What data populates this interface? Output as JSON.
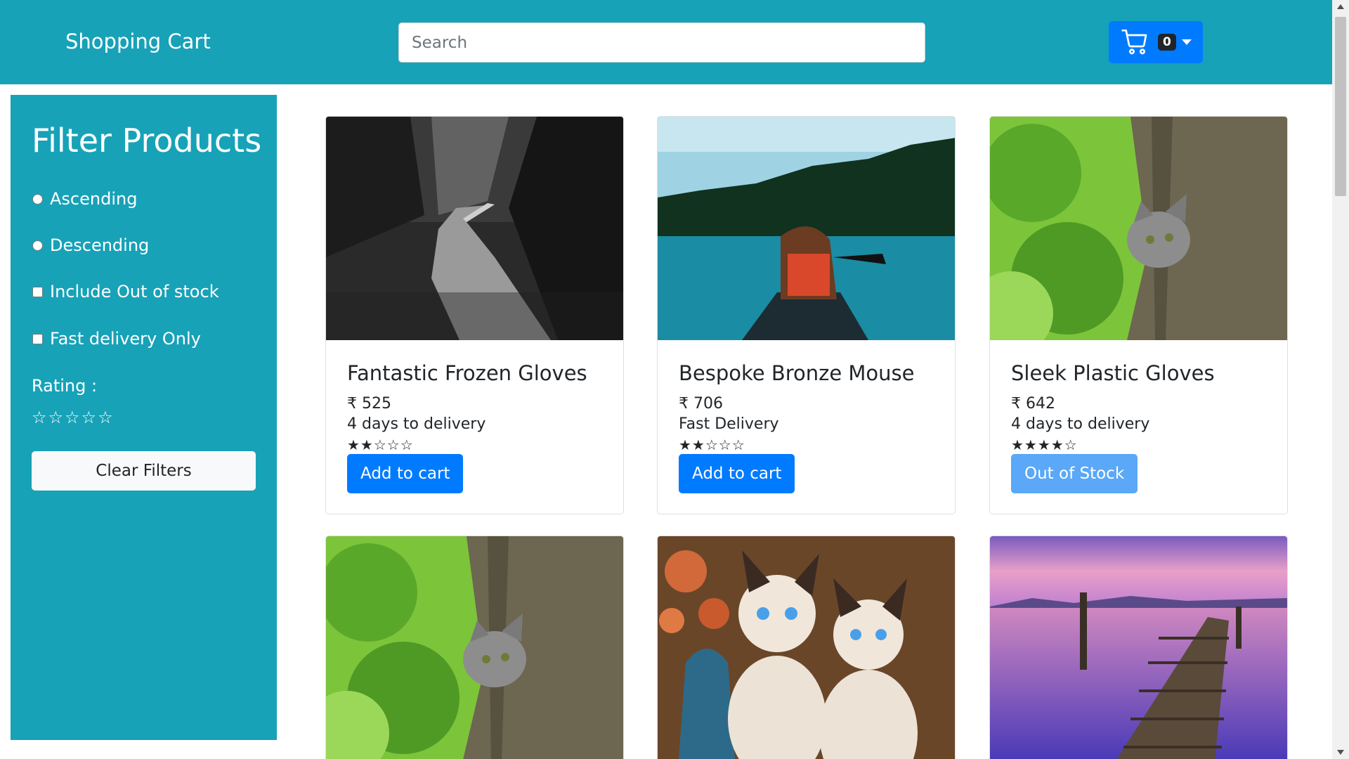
{
  "header": {
    "brand": "Shopping Cart",
    "search_placeholder": "Search",
    "cart_count": "0"
  },
  "filters": {
    "title": "Filter Products",
    "ascending": "Ascending",
    "descending": "Descending",
    "include_out_of_stock": "Include Out of stock",
    "fast_delivery_only": "Fast delivery Only",
    "rating_label": "Rating :",
    "rating_stars": "☆☆☆☆☆",
    "clear_button": "Clear Filters"
  },
  "products": [
    {
      "name": "Fantastic Frozen Gloves",
      "price": "₹ 525",
      "delivery": "4 days to delivery",
      "rating": 2,
      "stars": "★★☆☆☆",
      "button": "Add to cart",
      "in_stock": true,
      "image": "forest-road-photo"
    },
    {
      "name": "Bespoke Bronze Mouse",
      "price": "₹ 706",
      "delivery": "Fast Delivery",
      "rating": 2,
      "stars": "★★☆☆☆",
      "button": "Add to cart",
      "in_stock": true,
      "image": "canoe-lake-photo"
    },
    {
      "name": "Sleek Plastic Gloves",
      "price": "₹ 642",
      "delivery": "4 days to delivery",
      "rating": 4,
      "stars": "★★★★☆",
      "button": "Out of Stock",
      "in_stock": false,
      "image": "cat-tree-photo"
    },
    {
      "image": "cat-tree-photo"
    },
    {
      "image": "siamese-cats-photo"
    },
    {
      "image": "pier-sunset-photo"
    }
  ],
  "colors": {
    "header_bg": "#17a2b8",
    "primary": "#007bff",
    "primary_disabled": "#5aa8f7"
  }
}
